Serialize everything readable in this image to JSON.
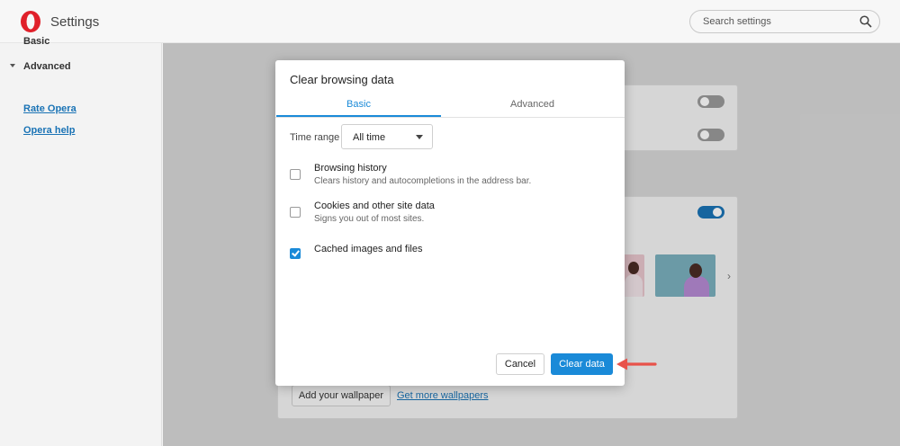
{
  "header": {
    "title": "Settings",
    "search_placeholder": "Search settings"
  },
  "sidebar": {
    "items": [
      {
        "label": "Basic"
      },
      {
        "label": "Advanced"
      }
    ],
    "links": [
      {
        "label": "Rate Opera"
      },
      {
        "label": "Opera help"
      }
    ]
  },
  "background": {
    "wallpaper_button": "Add your wallpaper",
    "more_wallpapers_link": "Get more wallpapers"
  },
  "dialog": {
    "title": "Clear browsing data",
    "tabs": [
      {
        "label": "Basic",
        "active": true
      },
      {
        "label": "Advanced",
        "active": false
      }
    ],
    "time_range_label": "Time range",
    "time_range_value": "All time",
    "options": [
      {
        "title": "Browsing history",
        "description": "Clears history and autocompletions in the address bar.",
        "checked": false
      },
      {
        "title": "Cookies and other site data",
        "description": "Signs you out of most sites.",
        "checked": false
      },
      {
        "title": "Cached images and files",
        "description": "",
        "checked": true
      }
    ],
    "cancel_label": "Cancel",
    "clear_label": "Clear data"
  },
  "colors": {
    "accent": "#1a8ad8",
    "annotation_arrow": "#e8524a"
  }
}
